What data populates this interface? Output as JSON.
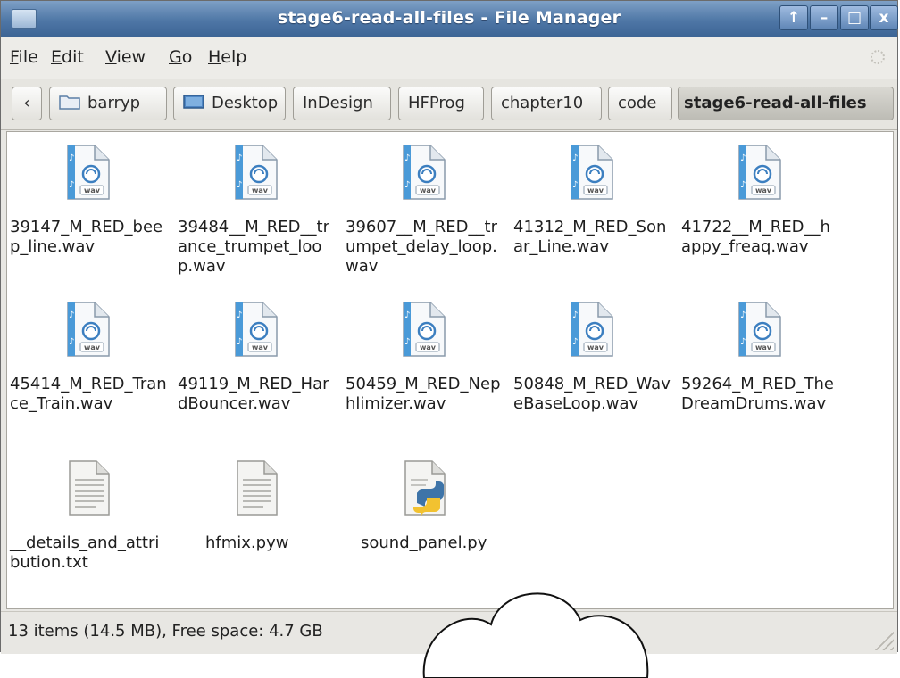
{
  "window": {
    "title": "stage6-read-all-files - File Manager",
    "controls": [
      "↑",
      "–",
      "□",
      "x"
    ]
  },
  "menu": [
    {
      "id": "file",
      "first": "F",
      "rest": "ile"
    },
    {
      "id": "edit",
      "first": "E",
      "rest": "dit"
    },
    {
      "id": "view",
      "first": "V",
      "rest": "iew"
    },
    {
      "id": "go",
      "first": "G",
      "rest": "o"
    },
    {
      "id": "help",
      "first": "H",
      "rest": "elp"
    }
  ],
  "path": {
    "back_arrow": "‹",
    "crumbs": [
      "barryp",
      "Desktop",
      "InDesign",
      "HFProg",
      "chapter10",
      "code",
      "stage6-read-all-files"
    ]
  },
  "files": [
    {
      "name": "39147_M_RED_beep_line.wav",
      "icon": "wav-audio-icon"
    },
    {
      "name": "39484__M_RED__trance_trumpet_loop.wav",
      "icon": "wav-audio-icon"
    },
    {
      "name": "39607__M_RED__trumpet_delay_loop.wav",
      "icon": "wav-audio-icon"
    },
    {
      "name": "41312_M_RED_Sonar_Line.wav",
      "icon": "wav-audio-icon"
    },
    {
      "name": "41722__M_RED__happy_freaq.wav",
      "icon": "wav-audio-icon"
    },
    {
      "name": "45414_M_RED_Trance_Train.wav",
      "icon": "wav-audio-icon"
    },
    {
      "name": "49119_M_RED_HardBouncer.wav",
      "icon": "wav-audio-icon"
    },
    {
      "name": "50459_M_RED_Nephlimizer.wav",
      "icon": "wav-audio-icon"
    },
    {
      "name": "50848_M_RED_WaveBaseLoop.wav",
      "icon": "wav-audio-icon"
    },
    {
      "name": "59264_M_RED_TheDreamDrums.wav",
      "icon": "wav-audio-icon"
    },
    {
      "name": "__details_and_attribution.txt",
      "icon": "text-file-icon"
    },
    {
      "name": "hfmix.pyw",
      "icon": "text-file-icon"
    },
    {
      "name": "sound_panel.py",
      "icon": "python-file-icon"
    }
  ],
  "status": "13 items (14.5 MB), Free space: 4.7 GB",
  "colors": {
    "titlebar": "#4f77a6",
    "wav_stripe": "#4a9ad8",
    "python_blue": "#3e74a8",
    "python_yellow": "#f2c230"
  }
}
